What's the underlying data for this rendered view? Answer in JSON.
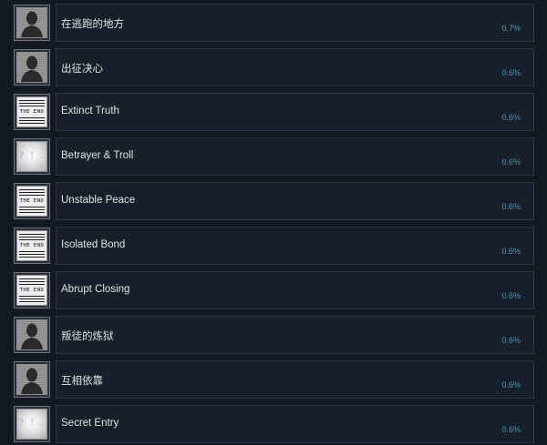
{
  "achievements": [
    {
      "name": "在逃跑的地方",
      "percent": "0.7%",
      "icon": "silhouette"
    },
    {
      "name": "出征决心",
      "percent": "0.6%",
      "icon": "silhouette"
    },
    {
      "name": "Extinct Truth",
      "percent": "0.6%",
      "icon": "the-end"
    },
    {
      "name": "Betrayer & Troll",
      "percent": "0.6%",
      "icon": "blurred"
    },
    {
      "name": "Unstable Peace",
      "percent": "0.6%",
      "icon": "the-end"
    },
    {
      "name": "Isolated Bond",
      "percent": "0.6%",
      "icon": "the-end"
    },
    {
      "name": "Abrupt Closing",
      "percent": "0.6%",
      "icon": "the-end"
    },
    {
      "name": "叛徒的炼狱",
      "percent": "0.6%",
      "icon": "silhouette"
    },
    {
      "name": "互相依靠",
      "percent": "0.6%",
      "icon": "silhouette"
    },
    {
      "name": "Secret Entry",
      "percent": "0.6%",
      "icon": "blurred"
    }
  ],
  "icon_text": {
    "the_end": "THE END",
    "blurred": "? !  ."
  },
  "colors": {
    "background": "#121921",
    "panel": "#171f28",
    "border": "#25394b",
    "percent": "#4f94bc",
    "text": "#dfe3e6"
  }
}
